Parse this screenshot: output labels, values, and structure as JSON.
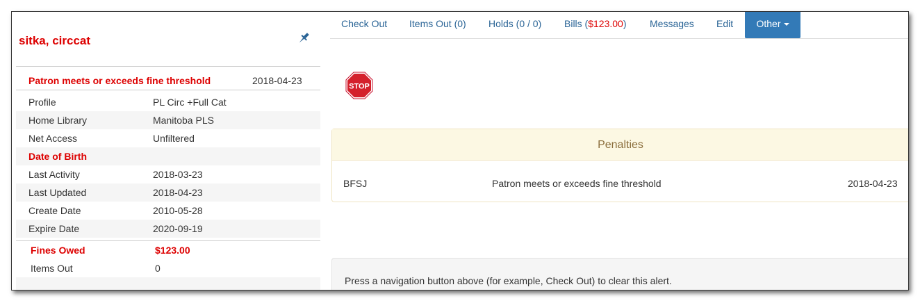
{
  "patron": {
    "name": "sitka, circcat"
  },
  "alert": {
    "label": "Patron meets or exceeds fine threshold",
    "date": "2018-04-23"
  },
  "details": [
    {
      "label": "Profile",
      "value": "PL Circ +Full Cat"
    },
    {
      "label": "Home Library",
      "value": "Manitoba PLS"
    },
    {
      "label": "Net Access",
      "value": "Unfiltered"
    },
    {
      "label": "Date of Birth",
      "value": ""
    },
    {
      "label": "Last Activity",
      "value": "2018-03-23"
    },
    {
      "label": "Last Updated",
      "value": "2018-04-23"
    },
    {
      "label": "Create Date",
      "value": "2010-05-28"
    },
    {
      "label": "Expire Date",
      "value": "2020-09-19"
    }
  ],
  "summary": {
    "fines_label": "Fines Owed",
    "fines_value": "$123.00",
    "items_label": "Items Out",
    "items_value": "0"
  },
  "tabs": {
    "check_out": "Check Out",
    "items_out": "Items Out (0)",
    "holds": "Holds (0 / 0)",
    "bills_prefix": "Bills (",
    "bills_amount": "$123.00",
    "bills_suffix": ")",
    "messages": "Messages",
    "edit": "Edit",
    "other": "Other"
  },
  "stop_sign": {
    "text": "STOP"
  },
  "penalties": {
    "title": "Penalties",
    "rows": [
      {
        "code": "BFSJ",
        "description": "Patron meets or exceeds fine threshold",
        "date": "2018-04-23"
      }
    ]
  },
  "notice": "Press a navigation button above (for example, Check Out) to clear this alert.",
  "colors": {
    "alert_red": "#dd0000",
    "link_blue": "#2a6496",
    "button_blue": "#337ab7",
    "warning_bg": "#fcf8e3"
  }
}
